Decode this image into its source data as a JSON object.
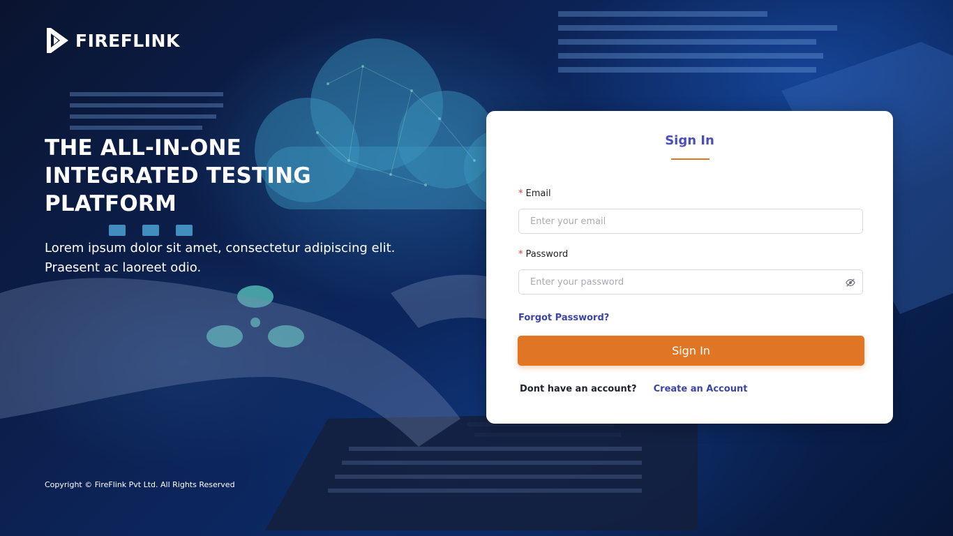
{
  "brand": {
    "name": "FIREFLINK"
  },
  "hero": {
    "title": "THE ALL-IN-ONE\nINTEGRATED TESTING\nPLATFORM",
    "subtitle": "Lorem ipsum dolor sit amet, consectetur adipiscing elit. Praesent ac laoreet odio."
  },
  "footer": {
    "copyright": "Copyright © FireFlink Pvt Ltd. All Rights Reserved"
  },
  "signin_form": {
    "title": "Sign In",
    "email": {
      "required_mark": "*",
      "label": "Email",
      "placeholder": "Enter your email",
      "value": ""
    },
    "password": {
      "required_mark": "*",
      "label": "Password",
      "placeholder": "Enter your password",
      "value": "",
      "toggle_icon": "eye-slash-icon"
    },
    "forgot_password_label": "Forgot Password?",
    "submit_label": "Sign In",
    "signup_prompt": "Dont have an account?",
    "signup_link_label": "Create an Account"
  },
  "colors": {
    "accent": "#e07524",
    "link": "#3b45a8",
    "title": "#4a4fb6",
    "required": "#e53935"
  }
}
